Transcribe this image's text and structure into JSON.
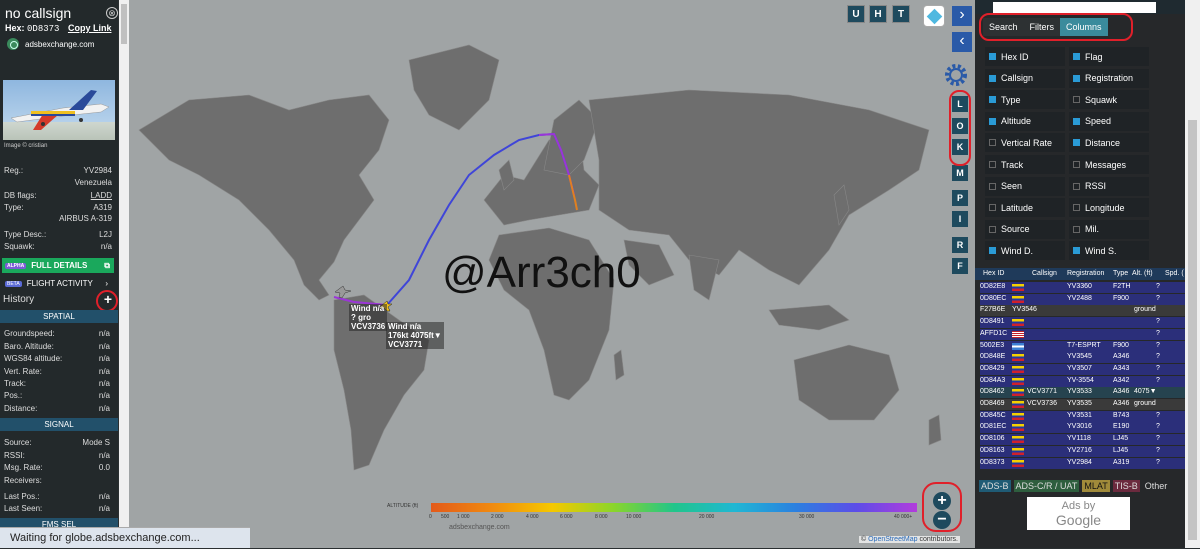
{
  "sidebar": {
    "title": "no callsign",
    "close_glyph": "⊗",
    "hex_label": "Hex:",
    "hex_value": "0D8373",
    "copy_link": "Copy Link",
    "site": "adsbexchange.com",
    "photo_credit": "Image © cristian",
    "fields": [
      {
        "label": "Reg.:",
        "value": "YV2984"
      },
      {
        "label": "",
        "value": "Venezuela"
      },
      {
        "label": "DB flags:",
        "value": "LADD"
      },
      {
        "label": "Type:",
        "value": "A319"
      },
      {
        "label": "",
        "value": "AIRBUS A-319"
      },
      {
        "label": "Type Desc.:",
        "value": "L2J"
      },
      {
        "label": "Squawk:",
        "value": "n/a"
      }
    ],
    "full_details": "FULL DETAILS",
    "alpha_badge": "ALPHA",
    "flight_activity": "FLIGHT ACTIVITY",
    "beta_badge": "BETA",
    "history": "History",
    "history_plus": "+",
    "spatial_header": "SPATIAL",
    "spatial": [
      {
        "label": "Groundspeed:",
        "value": "n/a"
      },
      {
        "label": "Baro. Altitude:",
        "value": "n/a"
      },
      {
        "label": "WGS84 altitude:",
        "value": "n/a"
      },
      {
        "label": "Vert. Rate:",
        "value": "n/a"
      },
      {
        "label": "Track:",
        "value": "n/a"
      },
      {
        "label": "Pos.:",
        "value": "n/a"
      },
      {
        "label": "Distance:",
        "value": "n/a"
      }
    ],
    "signal_header": "SIGNAL",
    "signal": [
      {
        "label": "Source:",
        "value": "Mode S"
      },
      {
        "label": "RSSI:",
        "value": "n/a"
      },
      {
        "label": "Msg. Rate:",
        "value": "0.0"
      },
      {
        "label": "Receivers:",
        "value": ""
      },
      {
        "label": "Last Pos.:",
        "value": "n/a"
      },
      {
        "label": "Last Seen:",
        "value": "n/a"
      }
    ],
    "fms_header": "FMS SEL"
  },
  "status_bar": "Waiting for globe.adsbexchange.com...",
  "map": {
    "watermark": "@Arr3ch0",
    "top_buttons": [
      "U",
      "H",
      "T"
    ],
    "side_buttons": [
      "L",
      "O",
      "K",
      "M",
      "P",
      "I",
      "R",
      "F"
    ],
    "aircraft_labels": [
      {
        "line1": "Wind n/a",
        "line2": "?   gro",
        "line3": "VCV3736"
      },
      {
        "line1": "Wind n/a",
        "line2": "176kt 4075ft▼",
        "line3": "VCV3771"
      }
    ],
    "zoom_in": "+",
    "zoom_out": "−",
    "altitude_label": "ALTITUDE (ft)",
    "altitude_ticks": [
      "0",
      "500",
      "1 000",
      "2 000",
      "4 000",
      "6 000",
      "8 000",
      "10 000",
      "20 000",
      "30 000",
      "40 000+"
    ],
    "site_logo_text": "adsbexchange.com",
    "osm_credit_pre": "© ",
    "osm_credit_link": "OpenStreetMap",
    "osm_credit_post": " contributors."
  },
  "right_panel": {
    "tabs": [
      "Search",
      "Filters",
      "Columns"
    ],
    "active_tab": "Columns",
    "columns": [
      {
        "label": "Hex ID",
        "on": true
      },
      {
        "label": "Flag",
        "on": true
      },
      {
        "label": "Callsign",
        "on": true
      },
      {
        "label": "Registration",
        "on": true
      },
      {
        "label": "Type",
        "on": true
      },
      {
        "label": "Squawk",
        "on": false
      },
      {
        "label": "Altitude",
        "on": true
      },
      {
        "label": "Speed",
        "on": true
      },
      {
        "label": "Vertical Rate",
        "on": false
      },
      {
        "label": "Distance",
        "on": true
      },
      {
        "label": "Track",
        "on": false
      },
      {
        "label": "Messages",
        "on": false
      },
      {
        "label": "Seen",
        "on": false
      },
      {
        "label": "RSSI",
        "on": false
      },
      {
        "label": "Latitude",
        "on": false
      },
      {
        "label": "Longitude",
        "on": false
      },
      {
        "label": "Source",
        "on": false
      },
      {
        "label": "Mil.",
        "on": false
      },
      {
        "label": "Wind D.",
        "on": true
      },
      {
        "label": "Wind S.",
        "on": true
      }
    ],
    "table_headers": [
      "Hex ID",
      "Callsign",
      "Registration",
      "Type",
      "Alt. (ft)",
      "Spd. ("
    ],
    "rows": [
      {
        "hex": "0D82E8",
        "flag": "ve",
        "callsign": "",
        "reg": "YV3360",
        "type": "F2TH",
        "alt": "?",
        "bg": "#2b2f7a"
      },
      {
        "hex": "0D80EC",
        "flag": "ve",
        "callsign": "",
        "reg": "YV2488",
        "type": "F900",
        "alt": "?",
        "bg": "#2b2f7a"
      },
      {
        "hex": "F27B6E",
        "flag": "",
        "callsign": "YV3546",
        "reg": "",
        "type": "",
        "alt": "ground",
        "bg": "#3a3a3a"
      },
      {
        "hex": "0D8491",
        "flag": "ve",
        "callsign": "",
        "reg": "",
        "type": "",
        "alt": "?",
        "bg": "#2b2f7a"
      },
      {
        "hex": "AFFD1C",
        "flag": "us",
        "callsign": "",
        "reg": "",
        "type": "",
        "alt": "?",
        "bg": "#2b2f7a"
      },
      {
        "hex": "5002E3",
        "flag": "ni",
        "callsign": "",
        "reg": "T7-ESPRT",
        "type": "F900",
        "alt": "?",
        "bg": "#2b2f7a"
      },
      {
        "hex": "0D848E",
        "flag": "ve",
        "callsign": "",
        "reg": "YV3545",
        "type": "A346",
        "alt": "?",
        "bg": "#2b2f7a"
      },
      {
        "hex": "0D8429",
        "flag": "ve",
        "callsign": "",
        "reg": "YV3507",
        "type": "A343",
        "alt": "?",
        "bg": "#2b2f7a"
      },
      {
        "hex": "0D84A3",
        "flag": "ve",
        "callsign": "",
        "reg": "YV-3554",
        "type": "A342",
        "alt": "?",
        "bg": "#2b2f7a"
      },
      {
        "hex": "0D8462",
        "flag": "ve",
        "callsign": "VCV3771",
        "reg": "YV3533",
        "type": "A346",
        "alt": "4075▼",
        "bg": "#26434f"
      },
      {
        "hex": "0D8469",
        "flag": "ve",
        "callsign": "VCV3736",
        "reg": "YV3535",
        "type": "A346",
        "alt": "ground",
        "bg": "#3a3a3a"
      },
      {
        "hex": "0D845C",
        "flag": "ve",
        "callsign": "",
        "reg": "YV3531",
        "type": "B743",
        "alt": "?",
        "bg": "#2b2f7a"
      },
      {
        "hex": "0D81EC",
        "flag": "ve",
        "callsign": "",
        "reg": "YV3016",
        "type": "E190",
        "alt": "?",
        "bg": "#2b2f7a"
      },
      {
        "hex": "0D8106",
        "flag": "ve",
        "callsign": "",
        "reg": "YV1118",
        "type": "LJ45",
        "alt": "?",
        "bg": "#2b2f7a"
      },
      {
        "hex": "0D8163",
        "flag": "ve",
        "callsign": "",
        "reg": "YV2716",
        "type": "LJ45",
        "alt": "?",
        "bg": "#2b2f7a"
      },
      {
        "hex": "0D8373",
        "flag": "ve",
        "callsign": "",
        "reg": "YV2984",
        "type": "A319",
        "alt": "?",
        "bg": "#2b2f7a"
      }
    ],
    "sources": [
      {
        "label": "ADS-B",
        "bg": "#1f5b75",
        "fg": "#ddd"
      },
      {
        "label": "ADS-C/R / UAT",
        "bg": "#2e5e3e",
        "fg": "#ddd"
      },
      {
        "label": "MLAT",
        "bg": "#a08a3a",
        "fg": "#111"
      },
      {
        "label": "TIS-B",
        "bg": "#6b2a3e",
        "fg": "#ddd"
      },
      {
        "label": "Other",
        "bg": "#26282a",
        "fg": "#ddd"
      }
    ],
    "ads_line1": "Ads by",
    "ads_line2": "Google"
  },
  "colors": {
    "accent": "#3a8b9c",
    "highlight": "#e0202a",
    "track": "#7b49e6"
  }
}
